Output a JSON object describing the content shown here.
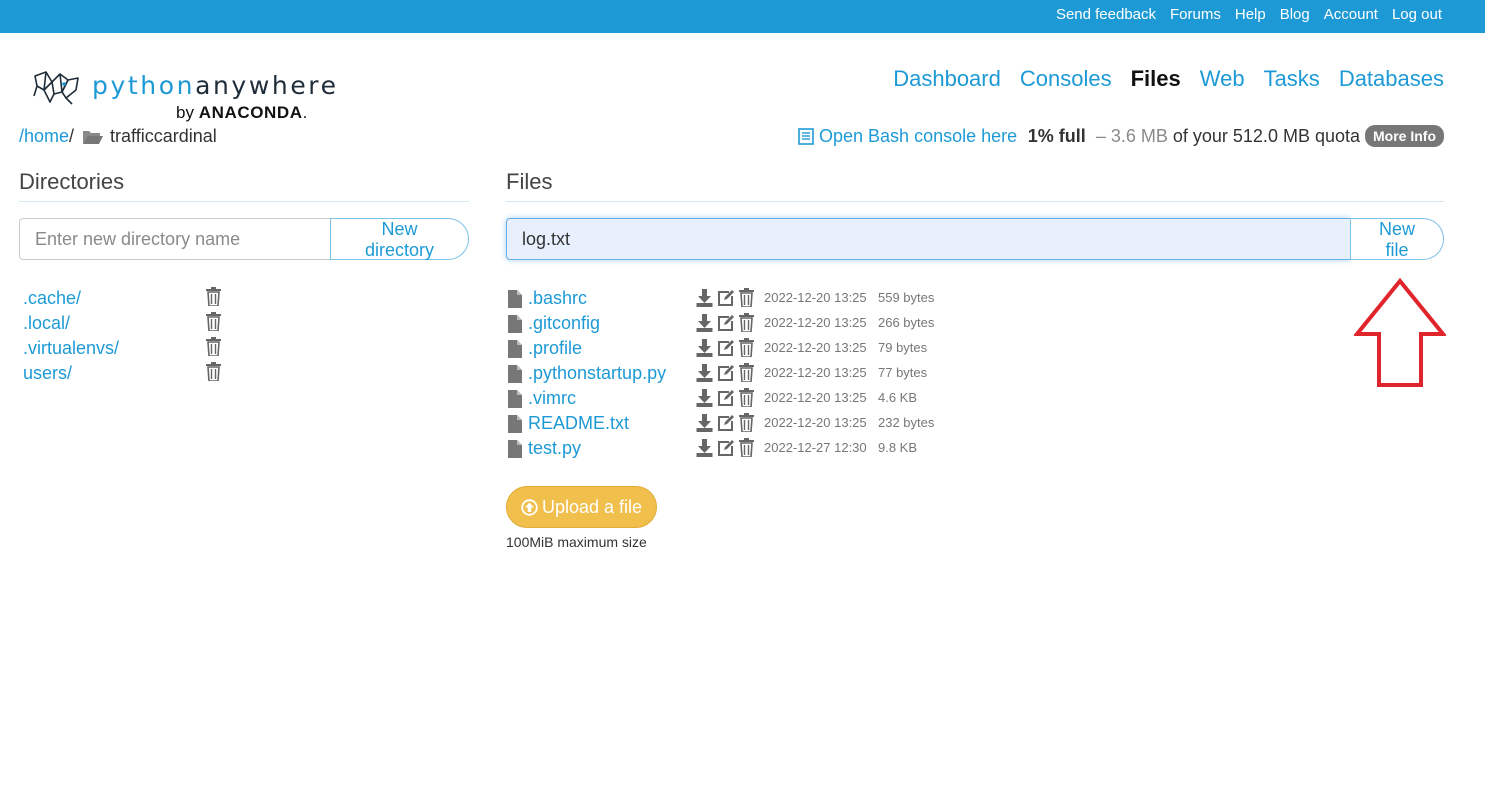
{
  "topbar": {
    "links": [
      "Send feedback",
      "Forums",
      "Help",
      "Blog",
      "Account",
      "Log out"
    ]
  },
  "logo": {
    "word_light": "python",
    "word_dark": "anywhere",
    "by": "by",
    "brand": "ANACONDA",
    "dot": "."
  },
  "nav": {
    "items": [
      "Dashboard",
      "Consoles",
      "Files",
      "Web",
      "Tasks",
      "Databases"
    ],
    "active": "Files"
  },
  "breadcrumb": {
    "home": "/home",
    "sep": "/",
    "current": "trafficcardinal"
  },
  "bash": {
    "label": "Open Bash console here"
  },
  "quota": {
    "percent": "1% full",
    "dash": "–",
    "used": "3.6 MB",
    "rest": "of your 512.0 MB quota",
    "more_info": "More Info"
  },
  "directories": {
    "heading": "Directories",
    "placeholder": "Enter new directory name",
    "button": "New directory",
    "items": [
      ".cache/",
      ".local/",
      ".virtualenvs/",
      "users/"
    ]
  },
  "files": {
    "heading": "Files",
    "input_value": "log.txt",
    "button": "New file",
    "items": [
      {
        "name": ".bashrc",
        "date": "2022-12-20 13:25",
        "size": "559 bytes"
      },
      {
        "name": ".gitconfig",
        "date": "2022-12-20 13:25",
        "size": "266 bytes"
      },
      {
        "name": ".profile",
        "date": "2022-12-20 13:25",
        "size": "79 bytes"
      },
      {
        "name": ".pythonstartup.py",
        "date": "2022-12-20 13:25",
        "size": "77 bytes"
      },
      {
        "name": ".vimrc",
        "date": "2022-12-20 13:25",
        "size": "4.6 KB"
      },
      {
        "name": "README.txt",
        "date": "2022-12-20 13:25",
        "size": "232 bytes"
      },
      {
        "name": "test.py",
        "date": "2022-12-27 12:30",
        "size": "9.8 KB"
      }
    ]
  },
  "upload": {
    "label": "Upload a file",
    "note": "100MiB maximum size"
  },
  "colors": {
    "brand_blue": "#1d9ad6",
    "upload_yellow": "#f0bf4c",
    "annotation_red": "#e0242b"
  },
  "icons": {
    "file": "file-icon",
    "download": "download-icon",
    "edit": "edit-icon",
    "delete": "trash-icon",
    "folder": "folder-open-icon",
    "console": "book-icon",
    "upload": "upload-circle-icon"
  }
}
